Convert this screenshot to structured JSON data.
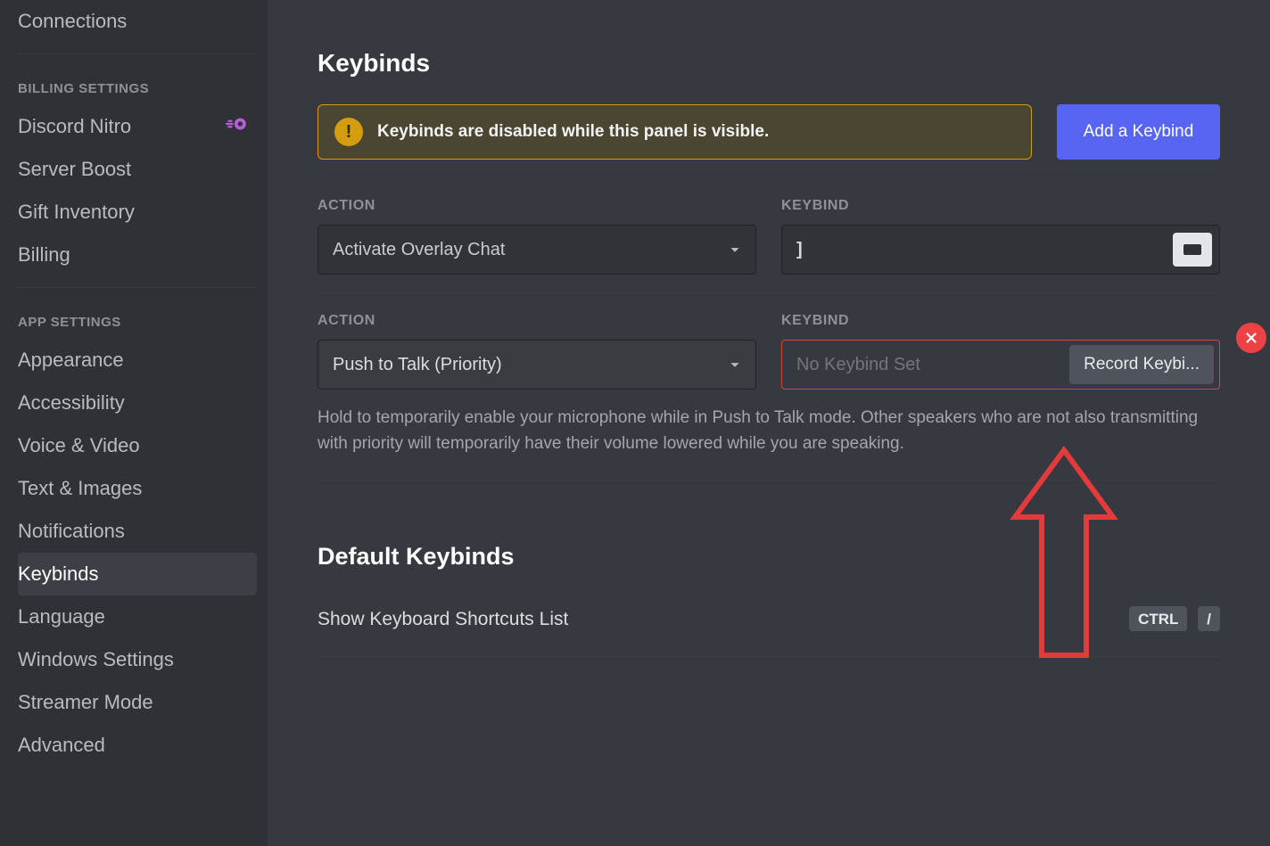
{
  "sidebar": {
    "items": [
      {
        "label": "Connections"
      }
    ],
    "billing_header": "BILLING SETTINGS",
    "billing_items": [
      {
        "label": "Discord Nitro",
        "badge": "nitro"
      },
      {
        "label": "Server Boost"
      },
      {
        "label": "Gift Inventory"
      },
      {
        "label": "Billing"
      }
    ],
    "app_header": "APP SETTINGS",
    "app_items": [
      {
        "label": "Appearance"
      },
      {
        "label": "Accessibility"
      },
      {
        "label": "Voice & Video"
      },
      {
        "label": "Text & Images"
      },
      {
        "label": "Notifications"
      },
      {
        "label": "Keybinds",
        "active": true
      },
      {
        "label": "Language"
      },
      {
        "label": "Windows Settings"
      },
      {
        "label": "Streamer Mode"
      },
      {
        "label": "Advanced"
      }
    ]
  },
  "page": {
    "title": "Keybinds",
    "notice": "Keybinds are disabled while this panel is visible.",
    "add_btn": "Add a Keybind",
    "action_label": "ACTION",
    "keybind_label": "KEYBIND",
    "row1": {
      "action": "Activate Overlay Chat",
      "keybind_value": "]"
    },
    "row2": {
      "action": "Push to Talk (Priority)",
      "placeholder": "No Keybind Set",
      "record_btn": "Record Keybi...",
      "description": "Hold to temporarily enable your microphone while in Push to Talk mode. Other speakers who are not also transmitting with priority will temporarily have their volume lowered while you are speaking."
    },
    "default_title": "Default Keybinds",
    "default_row": {
      "label": "Show Keyboard Shortcuts List",
      "keys": [
        "CTRL",
        "/"
      ]
    }
  }
}
